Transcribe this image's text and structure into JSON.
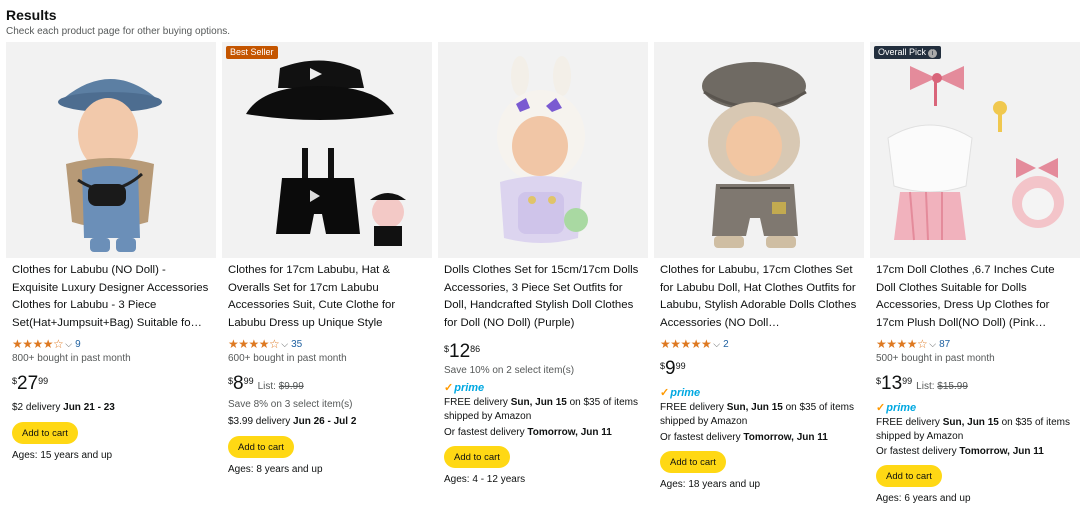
{
  "header": {
    "title": "Results",
    "subtitle": "Check each product page for other buying options."
  },
  "icons": {
    "star": "star-icon",
    "chevron": "chevron-down-icon",
    "info": "info-icon",
    "prime": "prime-check-icon"
  },
  "colors": {
    "star": "#de7921",
    "cart_button": "#ffd814",
    "best_seller": "#c45500",
    "overall_pick": "#232f3e",
    "prime": "#00a8e1"
  },
  "products": [
    {
      "title": "Clothes for Labubu (NO Doll) - Exquisite Luxury Designer Accessories Clothes for Labubu - 3 Piece Set(Hat+Jumpsuit+Bag) Suitable fo…",
      "stars": 3.5,
      "stars_text": "★★★★☆",
      "rating_count": "9",
      "bought": "800+ bought in past month",
      "price_symbol": "$",
      "price_whole": "27",
      "price_fraction": "99",
      "delivery_prefix": "$2 delivery ",
      "delivery_date": "Jun 21 - 23",
      "cart_label": "Add to cart",
      "ages": "Ages: 15 years and up"
    },
    {
      "badge": "Best Seller",
      "title": "Clothes for 17cm Labubu, Hat & Overalls Set for 17cm Labubu Accessories Suit, Cute Clothe for Labubu Dress up Unique Style",
      "stars": 4.0,
      "stars_text": "★★★★☆",
      "rating_count": "35",
      "bought": "600+ bought in past month",
      "price_symbol": "$",
      "price_whole": "8",
      "price_fraction": "99",
      "list_label": "List: ",
      "list_price": "$9.99",
      "save_text": "Save 8% on 3 select item(s)",
      "delivery_prefix": "$3.99 delivery ",
      "delivery_date": "Jun 26 - Jul 2",
      "cart_label": "Add to cart",
      "ages": "Ages: 8 years and up"
    },
    {
      "title": "Dolls Clothes Set for 15cm/17cm Dolls Accessories, 3 Piece Set Outfits for Doll, Handcrafted Stylish Doll Clothes for Doll (NO Doll) (Purple)",
      "price_symbol": "$",
      "price_whole": "12",
      "price_fraction": "86",
      "save_text": "Save 10% on 2 select item(s)",
      "prime": "prime",
      "free_delivery_prefix": "FREE delivery ",
      "free_delivery_date": "Sun, Jun 15",
      "free_delivery_suffix": " on $35 of items shipped by Amazon",
      "fastest_prefix": "Or fastest delivery ",
      "fastest_date": "Tomorrow, Jun 11",
      "cart_label": "Add to cart",
      "ages": "Ages: 4 - 12 years"
    },
    {
      "title": "Clothes for Labubu, 17cm Clothes Set for Labubu Doll, Hat Clothes Outfits for Labubu, Stylish Adorable Dolls Clothes Accessories (NO Doll…",
      "stars": 4.5,
      "stars_text": "★★★★★",
      "rating_count": "2",
      "price_symbol": "$",
      "price_whole": "9",
      "price_fraction": "99",
      "prime": "prime",
      "free_delivery_prefix": "FREE delivery ",
      "free_delivery_date": "Sun, Jun 15",
      "free_delivery_suffix": " on $35 of items shipped by Amazon",
      "fastest_prefix": "Or fastest delivery ",
      "fastest_date": "Tomorrow, Jun 11",
      "cart_label": "Add to cart",
      "ages": "Ages: 18 years and up"
    },
    {
      "badge": "Overall Pick",
      "title": "17cm Doll Clothes ,6.7 Inches Cute Doll Clothes Suitable for Dolls Accessories, Dress Up Clothes for 17cm Plush Doll(NO Doll) (Pink…",
      "stars": 4.5,
      "stars_text": "★★★★☆",
      "rating_count": "87",
      "bought": "500+ bought in past month",
      "price_symbol": "$",
      "price_whole": "13",
      "price_fraction": "99",
      "list_label": "List: ",
      "list_price": "$15.99",
      "prime": "prime",
      "free_delivery_prefix": "FREE delivery ",
      "free_delivery_date": "Sun, Jun 15",
      "free_delivery_suffix": " on $35 of items shipped by Amazon",
      "fastest_prefix": "Or fastest delivery ",
      "fastest_date": "Tomorrow, Jun 11",
      "cart_label": "Add to cart",
      "ages": "Ages: 6 years and up"
    }
  ]
}
